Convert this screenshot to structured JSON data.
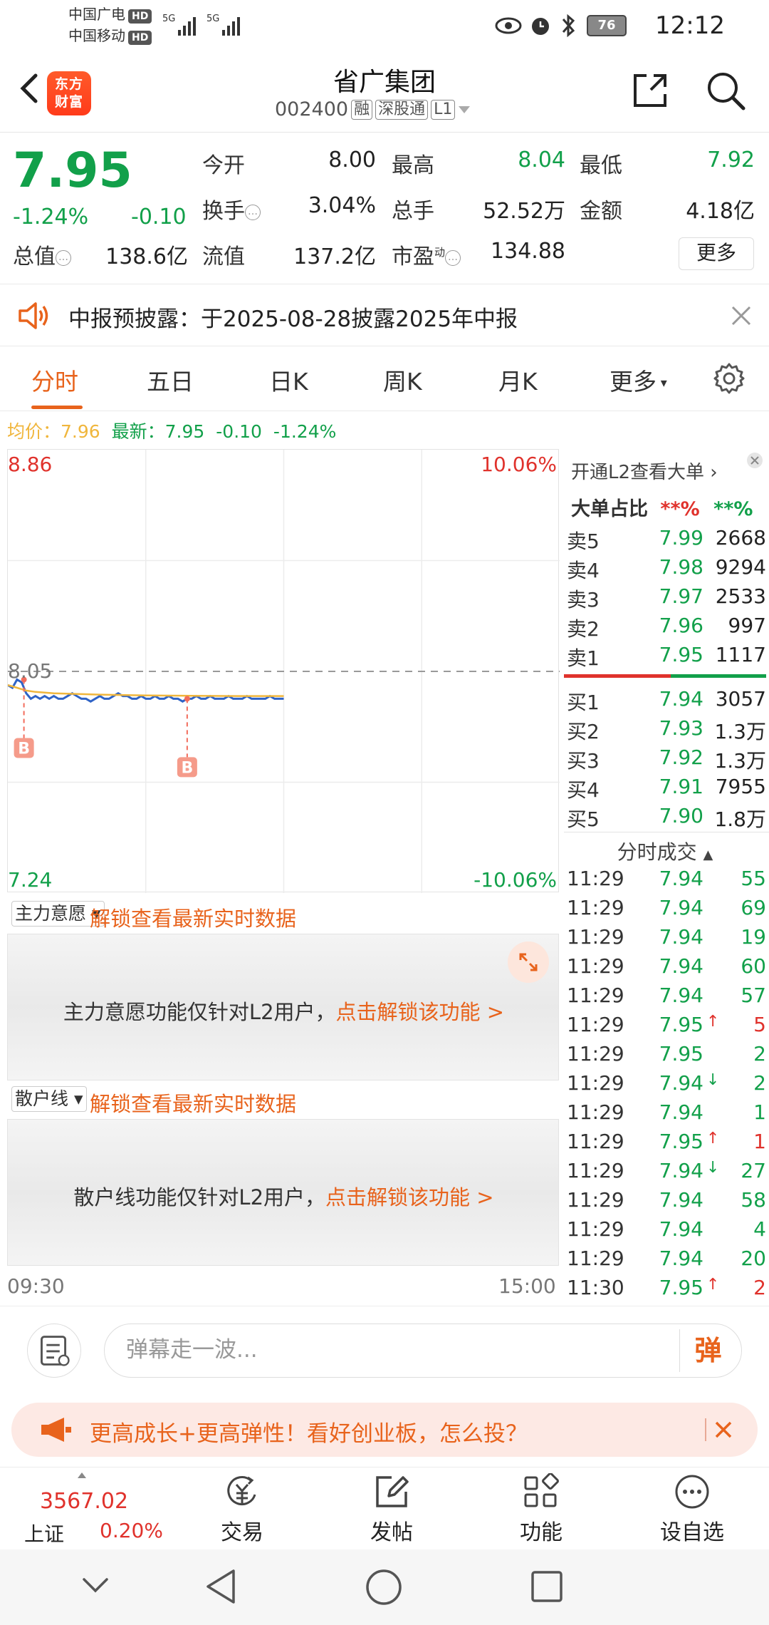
{
  "status_bar": {
    "carrier1": "中国广电",
    "carrier2": "中国移动",
    "hd": "HD",
    "signal1": "5G",
    "signal2": "5G",
    "battery": "76",
    "time": "12:12"
  },
  "header": {
    "logo_text_1": "东方",
    "logo_text_2": "财富",
    "title": "省广集团",
    "code": "002400",
    "tag_rong": "融",
    "tag_sgt": "深股通",
    "tag_l1": "L1"
  },
  "quote": {
    "price": "7.95",
    "pct_change": "-1.24%",
    "change": "-0.10",
    "labels": {
      "open": "今开",
      "high": "最高",
      "low": "最低",
      "turnover": "换手",
      "volume": "总手",
      "amount": "金额",
      "total_value": "总值",
      "float_value": "流值",
      "pe": "市盈"
    },
    "values": {
      "open": "8.00",
      "high": "8.04",
      "low": "7.92",
      "turnover": "3.04%",
      "volume": "52.52万",
      "amount": "4.18亿",
      "total_value": "138.6亿",
      "float_value": "137.2亿",
      "pe": "134.88"
    },
    "pe_tag": "动",
    "more_label": "更多"
  },
  "notice": {
    "text": "中报预披露：于2025-08-28披露2025年中报"
  },
  "tabs": {
    "items": [
      "分时",
      "五日",
      "日K",
      "周K",
      "月K",
      "更多"
    ]
  },
  "avg_line": {
    "avg_label": "均价：",
    "avg_value": "7.96",
    "latest_label": "最新：",
    "latest_value": "7.95",
    "latest_change": "-0.10",
    "latest_pct": "-1.24%"
  },
  "chart_data": {
    "type": "line",
    "title": "",
    "y_max_label": "8.86",
    "y_min_label": "7.24",
    "y_pct_max": "10.06%",
    "y_pct_min": "-10.06%",
    "ref_price_label": "8.05",
    "ylim": [
      7.24,
      8.86
    ],
    "reference_price": 8.05,
    "x_start_label": "09:30",
    "x_end_label": "15:00",
    "marker_label": "B",
    "series": [
      {
        "name": "价格",
        "x": [
          0,
          2,
          4,
          6,
          8,
          10,
          12,
          14,
          16,
          18,
          20,
          22,
          24,
          26,
          28,
          30,
          32,
          34,
          36,
          38,
          40,
          42,
          44,
          46,
          48,
          50,
          52,
          54,
          56,
          58,
          60,
          62,
          64,
          66,
          68,
          70,
          72,
          74,
          76,
          78,
          80,
          82,
          84,
          86,
          88,
          90,
          92,
          94,
          96,
          98,
          100,
          102,
          104,
          106,
          108,
          110,
          112,
          114,
          116,
          118,
          120
        ],
        "values": [
          8.0,
          7.99,
          8.02,
          8.01,
          7.97,
          7.95,
          7.96,
          7.95,
          7.96,
          7.95,
          7.96,
          7.95,
          7.95,
          7.96,
          7.97,
          7.96,
          7.95,
          7.95,
          7.94,
          7.95,
          7.96,
          7.95,
          7.95,
          7.96,
          7.97,
          7.96,
          7.96,
          7.95,
          7.95,
          7.96,
          7.95,
          7.95,
          7.96,
          7.95,
          7.95,
          7.96,
          7.95,
          7.95,
          7.94,
          7.95,
          7.95,
          7.96,
          7.95,
          7.95,
          7.96,
          7.95,
          7.95,
          7.95,
          7.96,
          7.95,
          7.95,
          7.95,
          7.96,
          7.95,
          7.95,
          7.95,
          7.95,
          7.96,
          7.95,
          7.95,
          7.95
        ],
        "color": "#2f63c6"
      },
      {
        "name": "均价",
        "x": [
          0,
          4,
          8,
          12,
          20,
          40,
          60,
          80,
          100,
          120
        ],
        "values": [
          8.0,
          7.99,
          7.98,
          7.975,
          7.97,
          7.965,
          7.962,
          7.961,
          7.96,
          7.96
        ],
        "color": "#f0b63c"
      }
    ],
    "markers": [
      {
        "x": 7,
        "value": 8.02
      },
      {
        "x": 78,
        "value": 7.95
      }
    ],
    "total_minutes": 240
  },
  "order_book": {
    "l2_link": "开通L2查看大单",
    "big_order_label": "大单占比",
    "big_order_sell": "**%",
    "big_order_buy": "**%",
    "asks": [
      {
        "label": "卖5",
        "price": "7.99",
        "vol": "2668"
      },
      {
        "label": "卖4",
        "price": "7.98",
        "vol": "9294"
      },
      {
        "label": "卖3",
        "price": "7.97",
        "vol": "2533"
      },
      {
        "label": "卖2",
        "price": "7.96",
        "vol": "997"
      },
      {
        "label": "卖1",
        "price": "7.95",
        "vol": "1117"
      }
    ],
    "bids": [
      {
        "label": "买1",
        "price": "7.94",
        "vol": "3057"
      },
      {
        "label": "买2",
        "price": "7.93",
        "vol": "1.3万"
      },
      {
        "label": "买3",
        "price": "7.92",
        "vol": "1.3万"
      },
      {
        "label": "买4",
        "price": "7.91",
        "vol": "7955"
      },
      {
        "label": "买5",
        "price": "7.90",
        "vol": "1.8万"
      }
    ],
    "ticks_header": "分时成交",
    "ticks": [
      {
        "time": "11:29",
        "price": "7.94",
        "vol": "55",
        "dir": ""
      },
      {
        "time": "11:29",
        "price": "7.94",
        "vol": "69",
        "dir": ""
      },
      {
        "time": "11:29",
        "price": "7.94",
        "vol": "19",
        "dir": ""
      },
      {
        "time": "11:29",
        "price": "7.94",
        "vol": "60",
        "dir": ""
      },
      {
        "time": "11:29",
        "price": "7.94",
        "vol": "57",
        "dir": ""
      },
      {
        "time": "11:29",
        "price": "7.95",
        "vol": "5",
        "dir": "up"
      },
      {
        "time": "11:29",
        "price": "7.95",
        "vol": "2",
        "dir": ""
      },
      {
        "time": "11:29",
        "price": "7.94",
        "vol": "2",
        "dir": "down"
      },
      {
        "time": "11:29",
        "price": "7.94",
        "vol": "1",
        "dir": ""
      },
      {
        "time": "11:29",
        "price": "7.95",
        "vol": "1",
        "dir": "up"
      },
      {
        "time": "11:29",
        "price": "7.94",
        "vol": "27",
        "dir": "down"
      },
      {
        "time": "11:29",
        "price": "7.94",
        "vol": "58",
        "dir": ""
      },
      {
        "time": "11:29",
        "price": "7.94",
        "vol": "4",
        "dir": ""
      },
      {
        "time": "11:29",
        "price": "7.94",
        "vol": "20",
        "dir": ""
      },
      {
        "time": "11:30",
        "price": "7.95",
        "vol": "2",
        "dir": "up"
      }
    ]
  },
  "panels": {
    "main_force": {
      "dropdown": "主力意愿",
      "unlock": "解锁查看最新实时数据",
      "msg": "主力意愿功能仅针对L2用户，",
      "msg_link": "点击解锁该功能 >"
    },
    "retail": {
      "dropdown": "散户线",
      "unlock": "解锁查看最新实时数据",
      "msg": "散户线功能仅针对L2用户，",
      "msg_link": "点击解锁该功能 >"
    }
  },
  "time_axis": {
    "start": "09:30",
    "end": "15:00"
  },
  "danmu": {
    "placeholder": "弹幕走一波...",
    "send": "弹"
  },
  "promo": {
    "text": "更高成长+更高弹性！看好创业板，怎么投？"
  },
  "bottom_nav": {
    "index_value": "3567.02",
    "index_name": "上证",
    "index_pct": "0.20%",
    "items": [
      "交易",
      "发帖",
      "功能",
      "设自选"
    ]
  },
  "colors": {
    "up": "#e0322c",
    "down": "#12a04a",
    "accent": "#e8631c",
    "avg": "#f0b63c",
    "price_line": "#2f63c6"
  }
}
